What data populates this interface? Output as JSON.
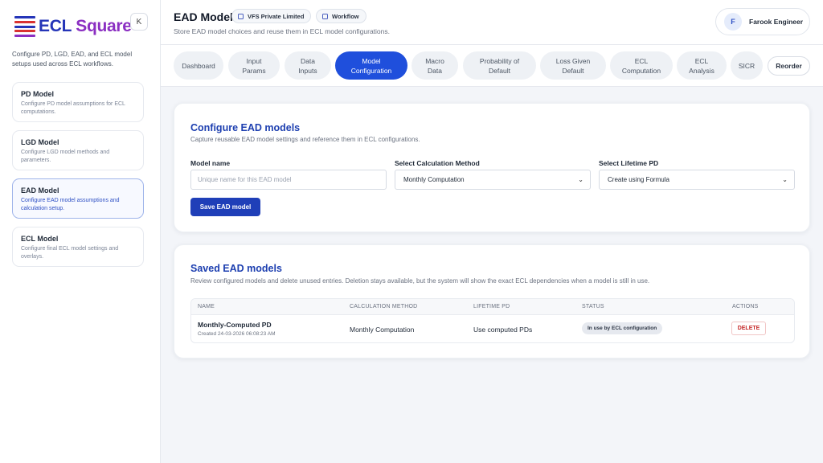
{
  "brand": {
    "name_part1": "ECL",
    "name_part2": "Square",
    "collapse_label": "K"
  },
  "sidebar": {
    "description": "Configure PD, LGD, EAD, and ECL model setups used across ECL workflows.",
    "items": [
      {
        "title": "PD Model",
        "desc": "Configure PD model assumptions for ECL computations.",
        "active": false
      },
      {
        "title": "LGD Model",
        "desc": "Configure LGD model methods and parameters.",
        "active": false
      },
      {
        "title": "EAD Model",
        "desc": "Configure EAD model assumptions and calculation setup.",
        "active": true
      },
      {
        "title": "ECL Model",
        "desc": "Configure final ECL model settings and overlays.",
        "active": false
      }
    ]
  },
  "header": {
    "title": "EAD Model",
    "chip_org": "VFS Private Limited",
    "chip_workflow": "Workflow",
    "subtitle": "Store EAD model choices and reuse them in ECL model configurations.",
    "user_initial": "F",
    "user_name": "Farook Engineer"
  },
  "tabs": [
    {
      "l1": "Dashboard",
      "l2": ""
    },
    {
      "l1": "Input",
      "l2": "Params"
    },
    {
      "l1": "Data",
      "l2": "Inputs"
    },
    {
      "l1": "Model",
      "l2": "Configuration"
    },
    {
      "l1": "Macro",
      "l2": "Data"
    },
    {
      "l1": "Probability of",
      "l2": "Default"
    },
    {
      "l1": "Loss Given",
      "l2": "Default"
    },
    {
      "l1": "ECL",
      "l2": "Computation"
    },
    {
      "l1": "ECL",
      "l2": "Analysis"
    },
    {
      "l1": "SICR",
      "l2": ""
    }
  ],
  "reorder_label": "Reorder",
  "configure": {
    "title": "Configure EAD models",
    "subtitle": "Capture reusable EAD model settings and reference them in ECL configurations.",
    "model_name_label": "Model name",
    "model_name_placeholder": "Unique name for this EAD model",
    "calc_method_label": "Select Calculation Method",
    "calc_method_value": "Monthly Computation",
    "lifetime_pd_label": "Select Lifetime PD",
    "lifetime_pd_value": "Create using Formula",
    "save_label": "Save EAD model"
  },
  "saved": {
    "title": "Saved EAD models",
    "subtitle": "Review configured models and delete unused entries. Deletion stays available, but the system will show the exact ECL dependencies when a model is still in use.",
    "columns": [
      "NAME",
      "CALCULATION METHOD",
      "LIFETIME PD",
      "STATUS",
      "ACTIONS"
    ],
    "rows": [
      {
        "name": "Monthly-Computed PD",
        "created": "Created 24-03-2026 06:08:23 AM",
        "method": "Monthly Computation",
        "lifetime_pd": "Use computed PDs",
        "status": "In use by ECL configuration",
        "action": "DELETE"
      }
    ]
  },
  "colors": {
    "primary": "#1f4fdc",
    "heading": "#1d3fb0",
    "delete": "#c62828"
  }
}
